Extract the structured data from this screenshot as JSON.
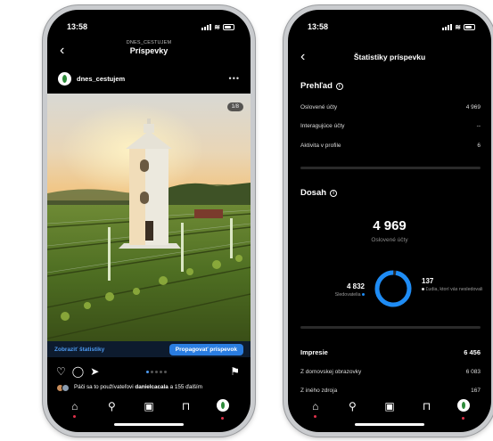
{
  "left": {
    "time": "13:58",
    "nav_subtitle": "DNES_CESTUJEM",
    "nav_title": "Príspevky",
    "username": "dnes_cestujem",
    "photo_counter": "1/8",
    "link_stats": "Zobraziť štatistiky",
    "btn_promote": "Propagovať príspevok",
    "likes_prefix": "Páči sa to používateľovi",
    "likes_user": "danielcacala",
    "likes_suffix": "a 155 ďalším"
  },
  "right": {
    "time": "13:58",
    "title": "Štatistiky príspevku",
    "overview": {
      "heading": "Prehľad",
      "rows": [
        {
          "label": "Oslovené účty",
          "value": "4 969"
        },
        {
          "label": "Interagujúce účty",
          "value": "--"
        },
        {
          "label": "Aktivita v profile",
          "value": "6"
        }
      ]
    },
    "reach": {
      "heading": "Dosah",
      "total": "4 969",
      "total_label": "Oslovené účty",
      "followers_value": "4 832",
      "followers_label": "Sledovatelia",
      "followers_share": 0.972,
      "non_followers_value": "137",
      "non_followers_label": "Ľudia, ktorí vás nesledovali"
    },
    "impressions": {
      "heading": "Impresie",
      "total": "6 456",
      "rows": [
        {
          "label": "Z domovskej obrazovky",
          "value": "6 083"
        },
        {
          "label": "Z iného zdroja",
          "value": "167"
        }
      ]
    }
  },
  "icons": {
    "back": "chevron-left-icon",
    "heart": "heart-icon",
    "comment": "comment-icon",
    "share": "share-icon",
    "save": "bookmark-icon",
    "home": "home-icon",
    "search": "search-icon",
    "reels": "reels-icon",
    "shop": "shop-icon"
  },
  "colors": {
    "accent_blue": "#2a7de1",
    "ring_blue": "#1e8cf5",
    "notif_red": "#e0314a"
  }
}
